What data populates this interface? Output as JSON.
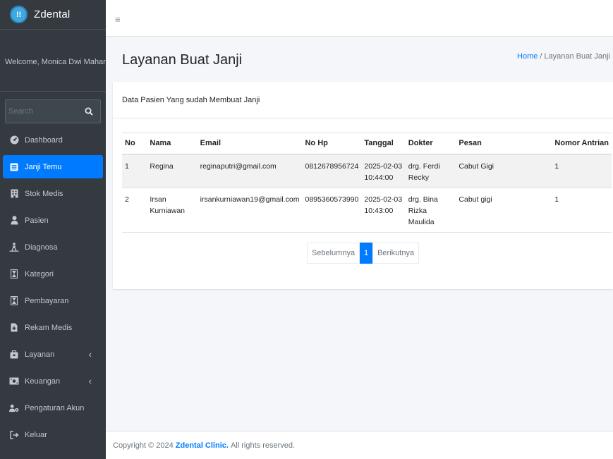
{
  "app": {
    "brand_name": "Zdental",
    "brand_logo_text": "!!"
  },
  "user": {
    "welcome": "Welcome, Monica Dwi Maharani"
  },
  "search": {
    "placeholder": "Search"
  },
  "sidebar": {
    "items": [
      {
        "label": "Dashboard",
        "icon": "dashboard-icon",
        "active": false
      },
      {
        "label": "Janji Temu",
        "icon": "calendar-list-icon",
        "active": true
      },
      {
        "label": "Stok Medis",
        "icon": "building-icon",
        "active": false
      },
      {
        "label": "Pasien",
        "icon": "user-icon",
        "active": false
      },
      {
        "label": "Diagnosa",
        "icon": "person-dolly-icon",
        "active": false
      },
      {
        "label": "Kategori",
        "icon": "hourglass-icon",
        "active": false
      },
      {
        "label": "Pembayaran",
        "icon": "hourglass-icon",
        "active": false
      },
      {
        "label": "Rekam Medis",
        "icon": "file-medical-icon",
        "active": false
      },
      {
        "label": "Layanan",
        "icon": "toolbox-icon",
        "active": false,
        "has_submenu": true
      },
      {
        "label": "Keuangan",
        "icon": "money-icon",
        "active": false,
        "has_submenu": true
      },
      {
        "label": "Pengaturan Akun",
        "icon": "users-cog-icon",
        "active": false
      },
      {
        "label": "Keluar",
        "icon": "sign-out-icon",
        "active": false
      }
    ],
    "caret": "‹"
  },
  "topbar": {
    "menu_icon": "≡"
  },
  "header": {
    "title": "Layanan Buat Janji",
    "breadcrumb_home": "Home",
    "breadcrumb_sep": "/",
    "breadcrumb_current": "Layanan Buat Janji"
  },
  "card": {
    "title": "Data Pasien Yang sudah Membuat Janji"
  },
  "table": {
    "columns": [
      "No",
      "Nama",
      "Email",
      "No Hp",
      "Tanggal",
      "Dokter",
      "Pesan",
      "Nomor Antrian"
    ],
    "rows": [
      [
        "1",
        "Regina",
        "reginaputri@gmail.com",
        "0812678956724",
        "2025-02-03 10:44:00",
        "drg. Ferdi Recky",
        "Cabut Gigi",
        "1"
      ],
      [
        "2",
        "Irsan Kurniawan",
        "irsankurniawan19@gmail.com",
        "0895360573990",
        "2025-02-03 10:43:00",
        "drg. Bina Rizka Maulida",
        "Cabut gigi",
        "1"
      ]
    ]
  },
  "pagination": {
    "prev": "Sebelumnya",
    "current": "1",
    "next": "Berikutnya"
  },
  "footer": {
    "prefix": "Copyright © 2024",
    "brand": "Zdental Clinic.",
    "suffix": "All rights reserved."
  },
  "colors": {
    "sidebar_bg": "#343a40",
    "accent": "#007bff",
    "content_bg": "#f4f6f9"
  }
}
